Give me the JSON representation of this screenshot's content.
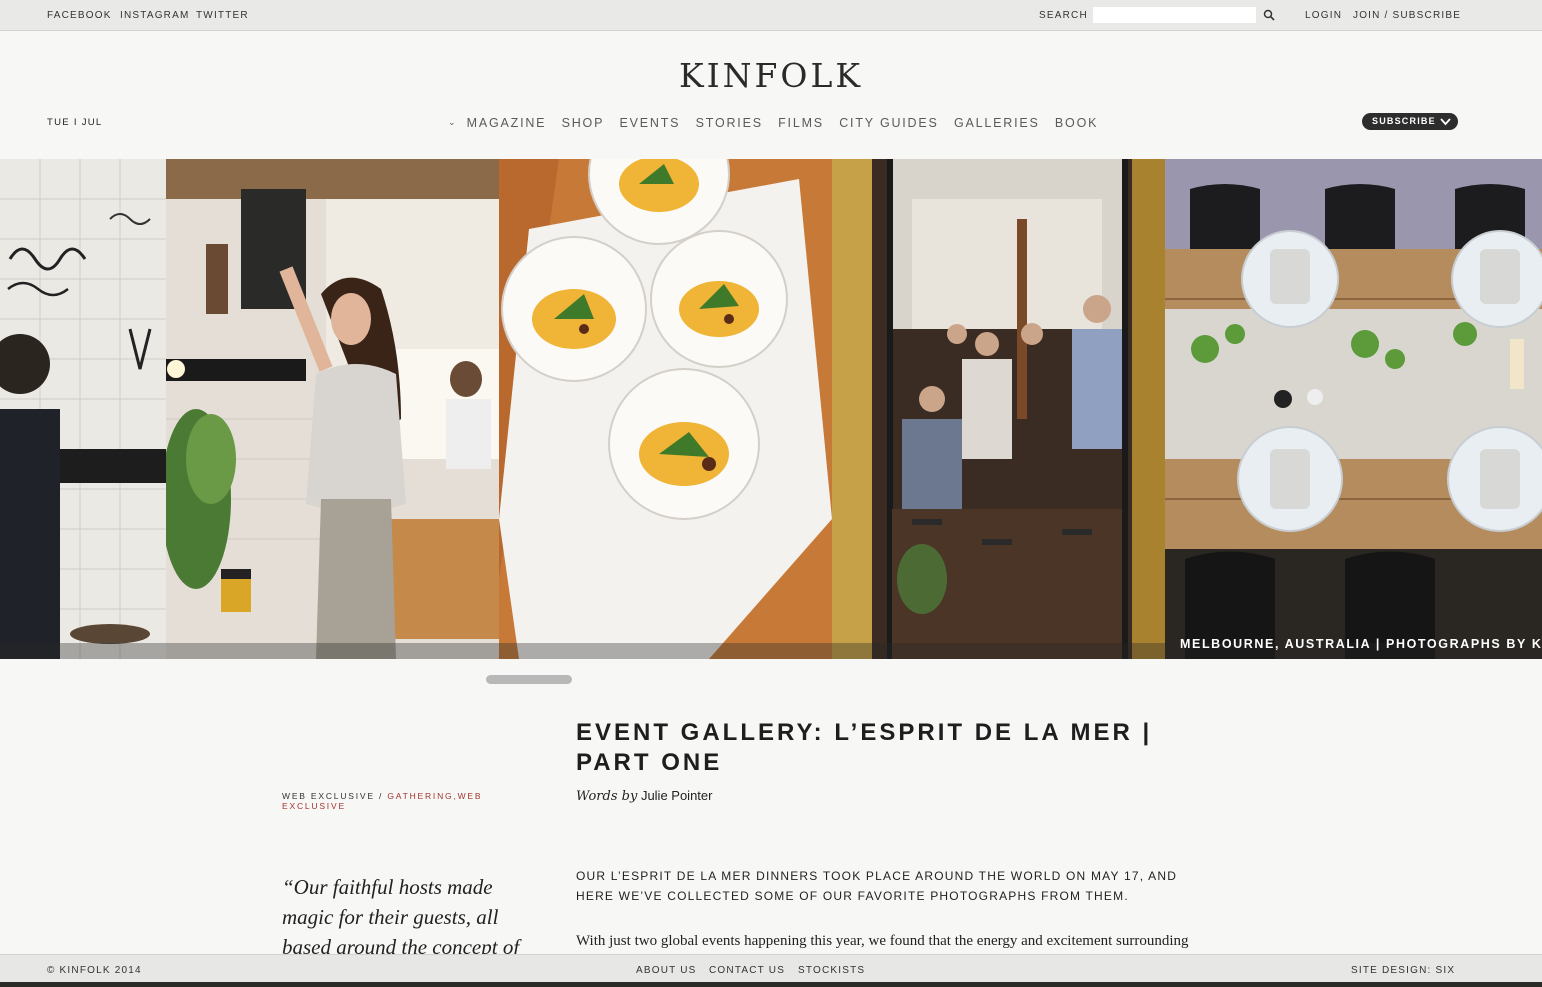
{
  "topbar": {
    "social": [
      "FACEBOOK",
      "INSTAGRAM",
      "TWITTER"
    ],
    "search_label": "SEARCH",
    "search_value": "",
    "login": "LOGIN",
    "join": "JOIN / SUBSCRIBE"
  },
  "header": {
    "logo": "KINFOLK",
    "date": "TUE I JUL",
    "nav": [
      "MAGAZINE",
      "SHOP",
      "EVENTS",
      "STORIES",
      "FILMS",
      "CITY GUIDES",
      "GALLERIES",
      "BOOK"
    ],
    "subscribe": "SUBSCRIBE"
  },
  "hero": {
    "caption": "MELBOURNE, AUSTRALIA | PHOTOGRAPHS BY KA"
  },
  "article": {
    "category_prefix": "WEB EXCLUSIVE",
    "category_sep": " / ",
    "category_tags": "GATHERING,WEB EXCLUSIVE",
    "title": "EVENT GALLERY: L’ESPRIT DE LA MER | PART ONE",
    "byline_words": "Words by",
    "byline_author": "Julie Pointer",
    "pullquote": "“Our faithful hosts made magic for their guests, all based around the concept of",
    "lede": "OUR L’ESPRIT DE LA MER DINNERS TOOK PLACE AROUND THE WORLD ON MAY 17, AND HERE WE’VE COLLECTED SOME OF OUR FAVORITE PHOTOGRAPHS FROM THEM.",
    "body": "With just two global events happening this year, we found that the energy and excitement surrounding"
  },
  "footer": {
    "copyright": "© KINFOLK 2014",
    "links": [
      "ABOUT US",
      "CONTACT US",
      "STOCKISTS"
    ],
    "credit": "SITE DESIGN: SIX"
  },
  "colors": {
    "accent_red": "#a3352f",
    "dark": "#2d2d2d",
    "background": "#f7f7f5"
  },
  "icons": [
    "search-icon",
    "chevron-down-icon"
  ]
}
